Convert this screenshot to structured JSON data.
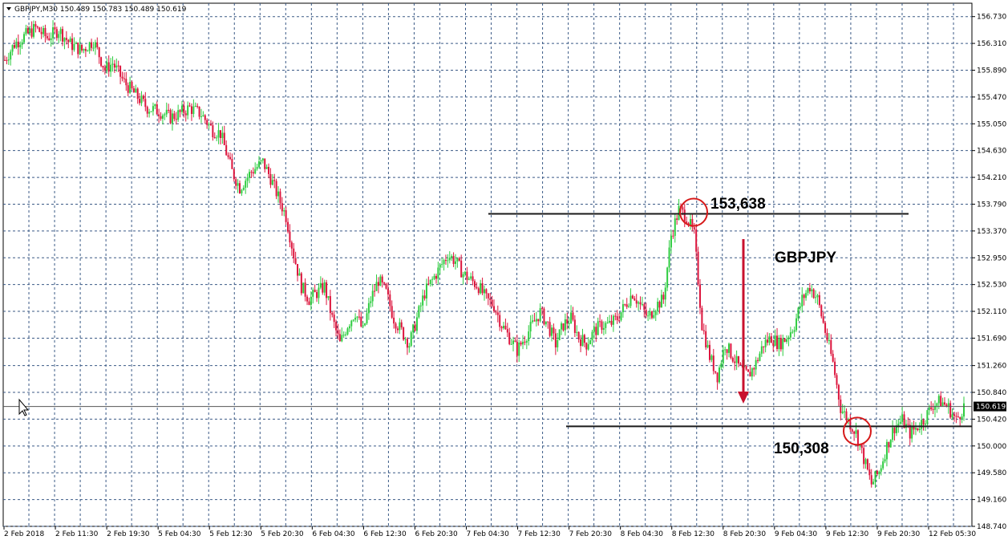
{
  "header": {
    "info": "GBPJPY,M30  150.489 150.783 150.489 150.619"
  },
  "colors": {
    "bull": "#2ecc40",
    "bear": "#dc143c",
    "grid": "#3b5a86",
    "level_line": "#1a1a1a",
    "circle": "#d61a1a",
    "arrow": "#c8102e",
    "price_tag": "#000000"
  },
  "annotations": {
    "resistance_label": "153,638",
    "support_label": "150,308",
    "symbol_label": "GBPJPY"
  },
  "chart_data": {
    "type": "candlestick",
    "symbol": "GBPJPY",
    "timeframe": "M30",
    "ylim": [
      148.74,
      156.94
    ],
    "grid": true,
    "current_price": 150.619,
    "y_ticks": [
      "156.730",
      "156.310",
      "155.890",
      "155.470",
      "155.050",
      "154.630",
      "154.210",
      "153.790",
      "153.370",
      "152.950",
      "152.530",
      "152.110",
      "151.690",
      "151.260",
      "150.840",
      "150.420",
      "150.000",
      "149.580",
      "149.160",
      "148.740"
    ],
    "y_tick_values": [
      156.73,
      156.31,
      155.89,
      155.47,
      155.05,
      154.63,
      154.21,
      153.79,
      153.37,
      152.95,
      152.53,
      152.11,
      151.69,
      151.26,
      150.84,
      150.42,
      150.0,
      149.58,
      149.16,
      148.74
    ],
    "x_ticks": [
      "2 Feb 2018",
      "2 Feb 11:30",
      "2 Feb 19:30",
      "5 Feb 04:30",
      "5 Feb 12:30",
      "5 Feb 20:30",
      "6 Feb 04:30",
      "6 Feb 12:30",
      "6 Feb 20:30",
      "7 Feb 04:30",
      "7 Feb 12:30",
      "7 Feb 20:30",
      "8 Feb 04:30",
      "8 Feb 12:30",
      "8 Feb 20:30",
      "9 Feb 04:30",
      "9 Feb 12:30",
      "9 Feb 20:30",
      "12 Feb 05:30"
    ],
    "levels": [
      {
        "name": "resistance",
        "value": 153.638
      },
      {
        "name": "support",
        "value": 150.308
      }
    ],
    "close_path": [
      [
        0,
        156.05
      ],
      [
        5,
        156.3
      ],
      [
        10,
        156.42
      ],
      [
        16,
        156.55
      ],
      [
        22,
        156.4
      ],
      [
        28,
        156.52
      ],
      [
        34,
        156.3
      ],
      [
        40,
        156.2
      ],
      [
        46,
        156.35
      ],
      [
        52,
        155.9
      ],
      [
        56,
        156.0
      ],
      [
        62,
        155.7
      ],
      [
        68,
        155.5
      ],
      [
        74,
        155.3
      ],
      [
        80,
        155.25
      ],
      [
        86,
        155.15
      ],
      [
        90,
        155.2
      ],
      [
        96,
        155.3
      ],
      [
        102,
        155.2
      ],
      [
        108,
        154.95
      ],
      [
        112,
        154.9
      ],
      [
        118,
        154.3
      ],
      [
        122,
        154.05
      ],
      [
        128,
        154.3
      ],
      [
        134,
        154.45
      ],
      [
        138,
        154.2
      ],
      [
        142,
        153.9
      ],
      [
        146,
        153.6
      ],
      [
        150,
        153.0
      ],
      [
        154,
        152.5
      ],
      [
        158,
        152.3
      ],
      [
        162,
        152.4
      ],
      [
        166,
        152.5
      ],
      [
        170,
        152.0
      ],
      [
        174,
        151.6
      ],
      [
        178,
        151.9
      ],
      [
        182,
        152.1
      ],
      [
        186,
        151.8
      ],
      [
        190,
        152.3
      ],
      [
        194,
        152.6
      ],
      [
        198,
        152.4
      ],
      [
        202,
        152.0
      ],
      [
        206,
        151.8
      ],
      [
        210,
        151.6
      ],
      [
        214,
        152.0
      ],
      [
        218,
        152.4
      ],
      [
        222,
        152.6
      ],
      [
        226,
        152.8
      ],
      [
        230,
        153.0
      ],
      [
        234,
        152.9
      ],
      [
        238,
        152.7
      ],
      [
        242,
        152.6
      ],
      [
        246,
        152.5
      ],
      [
        250,
        152.3
      ],
      [
        254,
        152.2
      ],
      [
        258,
        151.9
      ],
      [
        262,
        151.7
      ],
      [
        266,
        151.5
      ],
      [
        270,
        151.7
      ],
      [
        274,
        151.9
      ],
      [
        278,
        152.1
      ],
      [
        282,
        151.9
      ],
      [
        286,
        151.6
      ],
      [
        290,
        151.9
      ],
      [
        294,
        152.0
      ],
      [
        298,
        151.7
      ],
      [
        302,
        151.6
      ],
      [
        306,
        151.8
      ],
      [
        310,
        151.9
      ],
      [
        314,
        151.9
      ],
      [
        318,
        152.0
      ],
      [
        322,
        152.2
      ],
      [
        326,
        152.4
      ],
      [
        330,
        152.2
      ],
      [
        334,
        152.0
      ],
      [
        338,
        152.2
      ],
      [
        342,
        152.3
      ],
      [
        346,
        153.3
      ],
      [
        350,
        153.7
      ],
      [
        354,
        153.6
      ],
      [
        358,
        153.3
      ],
      [
        362,
        151.9
      ],
      [
        366,
        151.4
      ],
      [
        370,
        151.1
      ],
      [
        374,
        151.6
      ],
      [
        378,
        151.4
      ],
      [
        382,
        151.2
      ],
      [
        386,
        151.1
      ],
      [
        390,
        151.3
      ],
      [
        394,
        151.6
      ],
      [
        398,
        151.7
      ],
      [
        402,
        151.6
      ],
      [
        406,
        151.7
      ],
      [
        410,
        151.9
      ],
      [
        414,
        152.3
      ],
      [
        418,
        152.5
      ],
      [
        422,
        152.3
      ],
      [
        426,
        151.8
      ],
      [
        430,
        151.3
      ],
      [
        434,
        150.6
      ],
      [
        438,
        150.4
      ],
      [
        442,
        150.2
      ],
      [
        446,
        149.8
      ],
      [
        450,
        149.4
      ],
      [
        454,
        149.6
      ],
      [
        458,
        150.0
      ],
      [
        462,
        150.3
      ],
      [
        466,
        150.4
      ],
      [
        470,
        150.2
      ],
      [
        474,
        150.3
      ],
      [
        478,
        150.45
      ],
      [
        482,
        150.65
      ],
      [
        486,
        150.7
      ],
      [
        490,
        150.6
      ],
      [
        494,
        150.4
      ],
      [
        498,
        150.62
      ]
    ]
  }
}
